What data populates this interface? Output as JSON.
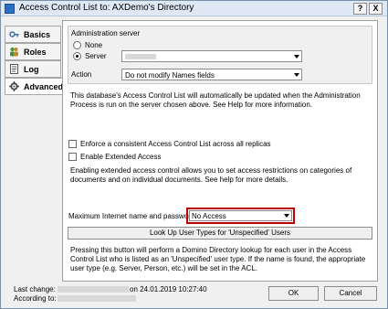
{
  "window": {
    "title": "Access Control List to: AXDemo's Directory",
    "help_label": "?",
    "close_label": "X"
  },
  "tabs": [
    {
      "label": "Basics",
      "icon": "key-icon"
    },
    {
      "label": "Roles",
      "icon": "people-icon"
    },
    {
      "label": "Log",
      "icon": "log-icon"
    },
    {
      "label": "Advanced",
      "icon": "gear-icon"
    }
  ],
  "admin_server": {
    "heading": "Administration server",
    "none_label": "None",
    "server_label": "Server",
    "action_label": "Action",
    "action_value": "Do not modify Names fields",
    "info": "This database's Access Control List will automatically be updated when the Administration Process is run on the server chosen above. See Help for more information."
  },
  "options": {
    "enforce_label": "Enforce a consistent Access Control List across all replicas",
    "extended_label": "Enable Extended Access",
    "extended_info": "Enabling extended access control allows you to set access restrictions on categories of documents and on individual documents. See help for more details."
  },
  "internet": {
    "label": "Maximum Internet name and password",
    "value": "No Access",
    "lookup_button": "Look Up User Types for 'Unspecified' Users",
    "lookup_info": "Pressing this button will perform a Domino Directory lookup for each user in the Access Control List who is listed as an 'Unspecified' user type.  If the name is found, the appropriate user type (e.g. Server, Person, etc.) will be set in the ACL."
  },
  "footer": {
    "last_change_label": "Last change:",
    "according_label": "According to:",
    "last_change_date": "on 24.01.2019 10:27:40",
    "ok_label": "OK",
    "cancel_label": "Cancel"
  },
  "colors": {
    "highlight_border": "#c00000"
  }
}
